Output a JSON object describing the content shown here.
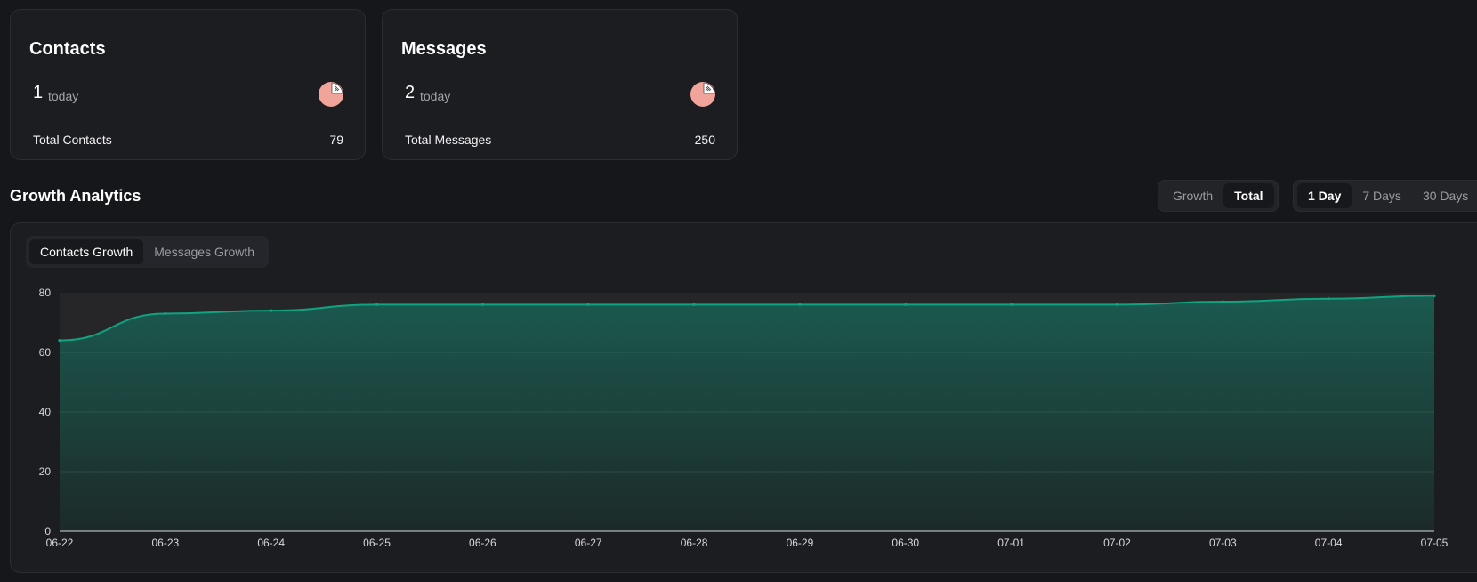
{
  "cards": {
    "contacts": {
      "title": "Contacts",
      "today_count": "1",
      "today_label": "today",
      "total_label": "Total Contacts",
      "total_value": "79",
      "pie_icon": "pie-chart-icon"
    },
    "messages": {
      "title": "Messages",
      "today_count": "2",
      "today_label": "today",
      "total_label": "Total Messages",
      "total_value": "250",
      "pie_icon": "pie-chart-icon"
    }
  },
  "section_title": "Growth Analytics",
  "mode_toggle": {
    "options": [
      "Growth",
      "Total"
    ],
    "selected": "Total"
  },
  "range_toggle": {
    "options": [
      "1 Day",
      "7 Days",
      "30 Days"
    ],
    "selected": "1 Day"
  },
  "chart_tabs": {
    "options": [
      "Contacts Growth",
      "Messages Growth"
    ],
    "selected": "Contacts Growth"
  },
  "colors": {
    "accent": "#10a37f",
    "area_top": "#1b5a4f",
    "pie": "#f1a49a"
  },
  "chart_data": {
    "type": "area",
    "x": [
      "06-22",
      "06-23",
      "06-24",
      "06-25",
      "06-26",
      "06-27",
      "06-28",
      "06-29",
      "06-30",
      "07-01",
      "07-02",
      "07-03",
      "07-04",
      "07-05"
    ],
    "series": [
      {
        "values": [
          64,
          73,
          74,
          76,
          76,
          76,
          76,
          76,
          76,
          76,
          76,
          77,
          78,
          79
        ]
      }
    ],
    "ylim": [
      0,
      80
    ],
    "yticks": [
      0,
      20,
      40,
      60,
      80
    ],
    "grid": true,
    "legend": "none"
  }
}
